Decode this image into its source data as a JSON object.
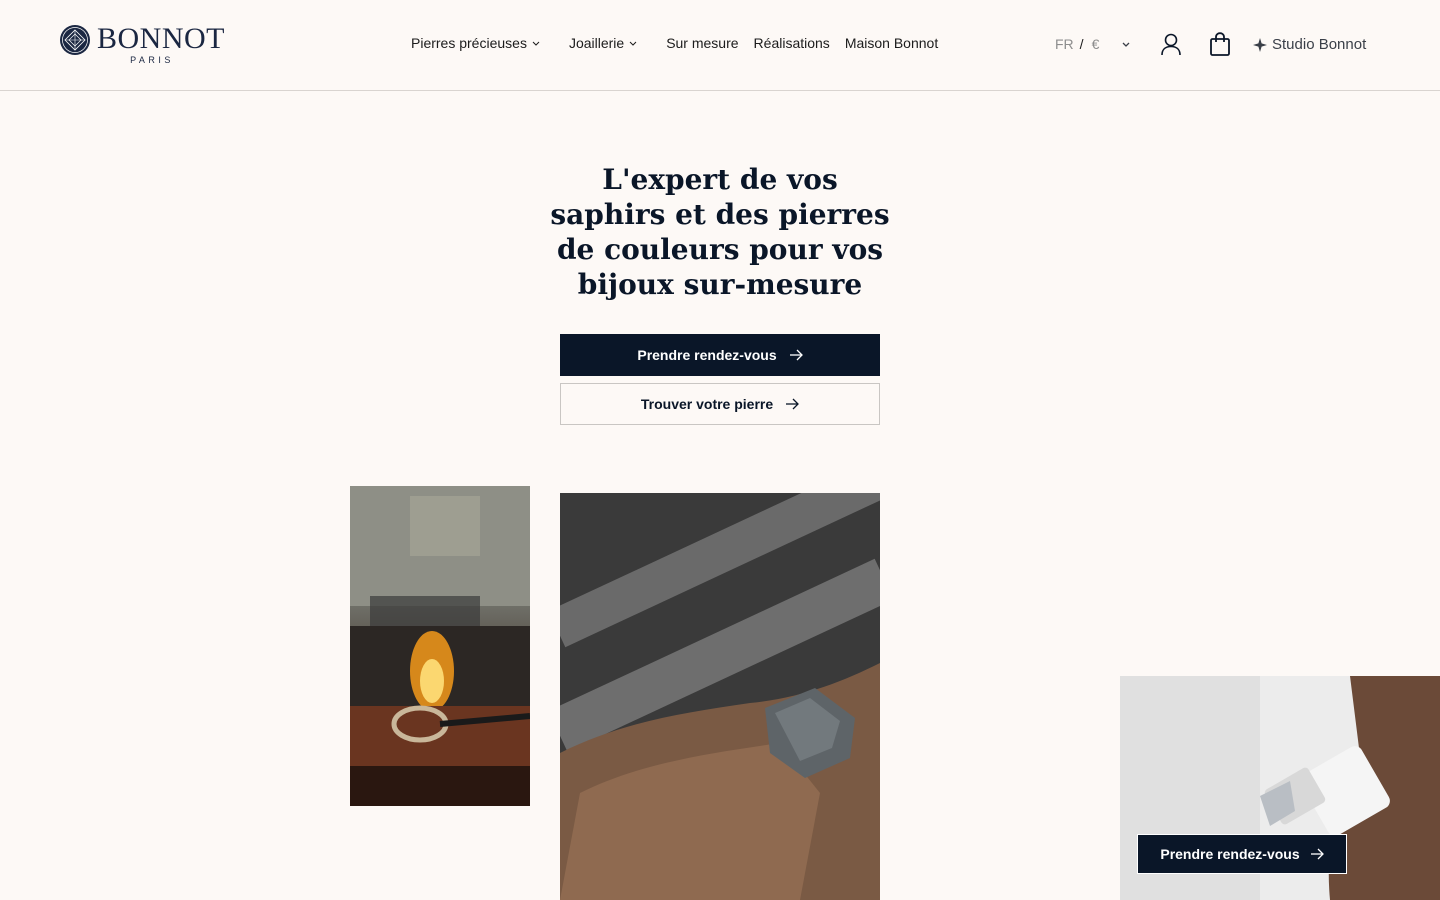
{
  "brand": {
    "name": "BONNOT",
    "tagline": "PARIS"
  },
  "nav": {
    "items": [
      {
        "label": "Pierres précieuses",
        "has_submenu": true
      },
      {
        "label": "Joaillerie",
        "has_submenu": true
      },
      {
        "label": "Sur mesure",
        "has_submenu": false
      },
      {
        "label": "Réalisations",
        "has_submenu": false
      },
      {
        "label": "Maison Bonnot",
        "has_submenu": false
      }
    ]
  },
  "locale": {
    "language": "FR",
    "separator": "/",
    "currency": "€"
  },
  "header_actions": {
    "account_icon": "user-icon",
    "cart_icon": "shopping-bag-icon",
    "studio_label": "Studio Bonnot",
    "studio_icon": "sparkle-icon"
  },
  "hero": {
    "title": "L'expert de vos saphirs et des pierres de couleurs pour vos bijoux sur-mesure",
    "primary_cta": "Prendre rendez-vous",
    "secondary_cta": "Trouver votre pierre"
  },
  "images": [
    {
      "name": "jeweler-torch-ring-image"
    },
    {
      "name": "rough-stone-hand-image"
    },
    {
      "name": "gemologist-loupe-image"
    }
  ],
  "floating_cta": {
    "label": "Prendre rendez-vous"
  },
  "colors": {
    "background": "#fdf9f6",
    "navy": "#0a1628",
    "text": "#1c1c1c",
    "muted": "#8d8d8d"
  }
}
